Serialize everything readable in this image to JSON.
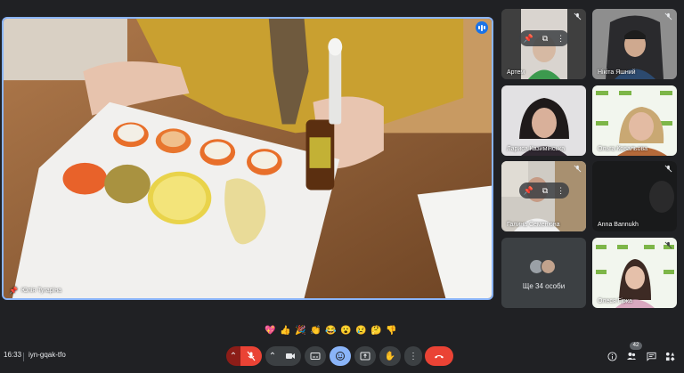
{
  "main": {
    "speaker_name": "Юлія Тугаріна"
  },
  "tiles": [
    {
      "name": "Артем",
      "muted": true,
      "pinned_controls": true
    },
    {
      "name": "Нікіта Яшний",
      "muted": true
    },
    {
      "name": "Лариса Казимінська",
      "muted": false
    },
    {
      "name": "Ольга Ковальова",
      "muted": false
    },
    {
      "name": "Галина Семенюна",
      "muted": true,
      "pinned_controls": true
    },
    {
      "name": "Anna Bannukh",
      "muted": true
    },
    {
      "name": "Олеся Гірка",
      "muted": true
    }
  ],
  "more_tile": {
    "label": "Ще 34 особи"
  },
  "reactions": [
    "💖",
    "👍",
    "🎉",
    "👏",
    "😂",
    "😮",
    "😢",
    "🤔",
    "👎"
  ],
  "bottom_bar": {
    "time": "16:33",
    "meeting_code": "iyn-gqak-tfo",
    "participants_count": "42"
  },
  "colors": {
    "background": "#202124",
    "control": "#3c4043",
    "hangup": "#ea4335",
    "active_blue": "#8ab4f8"
  }
}
